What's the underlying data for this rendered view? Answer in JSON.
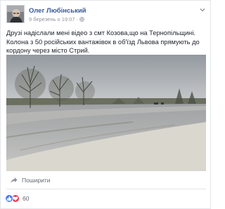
{
  "post": {
    "author": "Олег Любінський",
    "timestamp": "9 березень о 19:07",
    "privacy_icon": "globe-icon",
    "menu_icon": "chevron-down-icon",
    "text": "Друзі надіслали мені відео з смт Козова,що на Тернопільщині. Колона з 50 російських вантажівок в об'їзд Львова прямують до кордону через місто Стрий.",
    "video_watermark": "",
    "share_label": "Поширити",
    "reaction_count": "60",
    "reaction_icons": [
      "like-icon",
      "love-icon"
    ]
  },
  "colors": {
    "link": "#365899",
    "meta": "#90949c",
    "like": "#4c7ae6",
    "love": "#f0374f"
  }
}
